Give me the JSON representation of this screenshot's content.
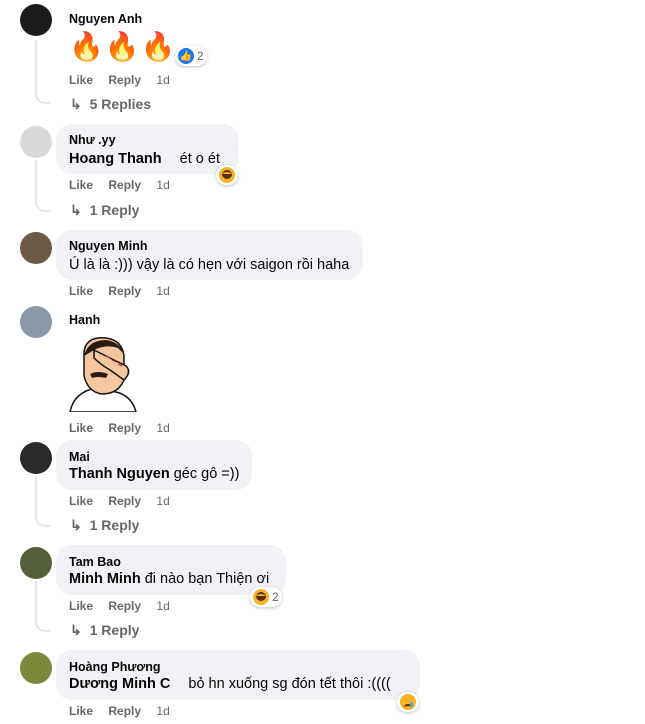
{
  "actions": {
    "like": "Like",
    "reply": "Reply",
    "time": "1d"
  },
  "comments": [
    {
      "author": "Nguyen Anh",
      "emoji_text": "🔥🔥🔥",
      "reaction_count": "2",
      "replies_label": "5 Replies"
    },
    {
      "author": "Như .yy",
      "mention": "Hoang Thanh",
      "text": "ét o ét",
      "replies_label": "1 Reply"
    },
    {
      "author": "Nguyen Minh",
      "text": "Ú là là :))) vậy là có hẹn với saigon rồi haha"
    },
    {
      "author": "Hanh",
      "sticker": "facepalm-sticker"
    },
    {
      "author": "Mai",
      "mention": "Thanh Nguyen",
      "text": "géc gô =))",
      "replies_label": "1 Reply"
    },
    {
      "author": "Tam Bao",
      "mention": "Minh Minh",
      "text": "đi nào bạn Thiện ơi",
      "reaction_count": "2",
      "replies_label": "1 Reply"
    },
    {
      "author": "Hoàng Phương",
      "mention": "Dương Minh C",
      "text": "bỏ hn xuống sg đón tết thôi :(((("
    }
  ],
  "colors": {
    "bubble": "#f0f2f5",
    "meta": "#65676b",
    "link": "#1877f2"
  }
}
